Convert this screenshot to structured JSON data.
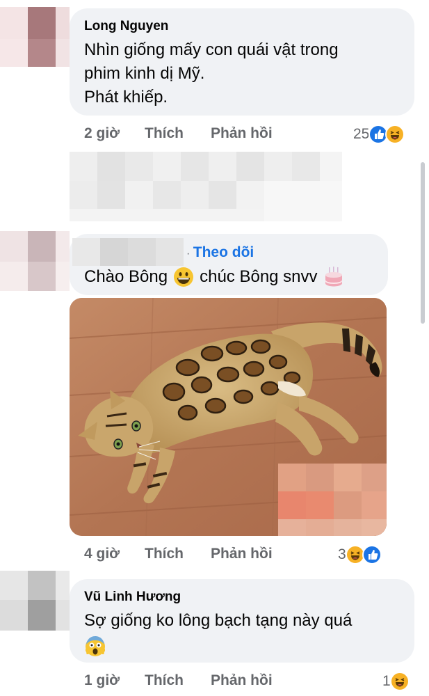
{
  "comments": [
    {
      "author": "Long Nguyen",
      "lines": [
        "Nhìn giống mấy con quái vật trong",
        "phim kinh dị Mỹ.",
        "Phát khiếp."
      ],
      "time": "2 giờ",
      "like": "Thích",
      "reply": "Phản hồi",
      "reaction_count": "25",
      "reactions": [
        "like-icon",
        "haha-icon"
      ]
    },
    {
      "follow": "Theo dõi",
      "text_a": "Chào Bông",
      "text_b": "chúc Bông snvv",
      "emojis": [
        "grinning-face-icon",
        "birthday-cake-icon"
      ],
      "time": "4 giờ",
      "like": "Thích",
      "reply": "Phản hồi",
      "reaction_count": "3",
      "reactions": [
        "haha-icon",
        "like-icon"
      ]
    },
    {
      "author": "Vũ Linh Hương",
      "text": "Sợ giống ko lông bạch tạng này quá",
      "emojis": [
        "screaming-face-icon"
      ],
      "time": "1 giờ",
      "like": "Thích",
      "reply": "Phản hồi",
      "reaction_count": "1",
      "reactions": [
        "haha-icon"
      ]
    }
  ],
  "colors": {
    "bubble": "#f0f2f5",
    "link": "#1b74e4",
    "meta": "#65676b",
    "like": "#1b74e4",
    "haha": "#f7b125"
  }
}
